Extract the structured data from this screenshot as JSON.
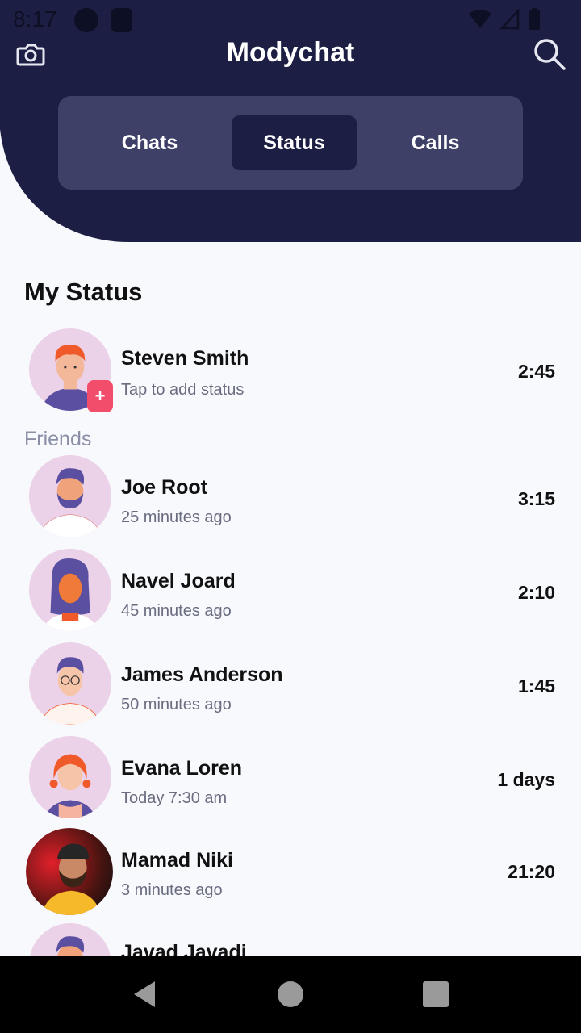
{
  "status_bar": {
    "time": "8:17"
  },
  "app": {
    "title": "Modychat"
  },
  "tabs": [
    {
      "label": "Chats",
      "active": false
    },
    {
      "label": "Status",
      "active": true
    },
    {
      "label": "Calls",
      "active": false
    }
  ],
  "my_status": {
    "section_title": "My Status",
    "name": "Steven Smith",
    "subtitle": "Tap to add status",
    "time": "2:45",
    "badge": "+"
  },
  "friends": {
    "label": "Friends",
    "items": [
      {
        "name": "Joe Root",
        "subtitle": "25 minutes ago",
        "time": "3:15",
        "avatar": "bearded-man-avatar"
      },
      {
        "name": "Navel Joard",
        "subtitle": "45 minutes ago",
        "time": "2:10",
        "avatar": "long-hair-avatar"
      },
      {
        "name": "James Anderson",
        "subtitle": "50 minutes ago",
        "time": "1:45",
        "avatar": "glasses-man-avatar"
      },
      {
        "name": "Evana Loren",
        "subtitle": "Today 7:30 am",
        "time": "1 days",
        "avatar": "red-hair-woman-avatar"
      },
      {
        "name": "Mamad Niki",
        "subtitle": "3 minutes ago",
        "time": "21:20",
        "avatar": "photo-avatar"
      },
      {
        "name": "Javad Javadi",
        "subtitle": "",
        "time": "",
        "avatar": "bearded-man-avatar"
      }
    ]
  },
  "colors": {
    "primary": "#1c1f43",
    "tab_bg": "#3e4068",
    "accent": "#f24d6b",
    "background": "#f8f9fd"
  }
}
